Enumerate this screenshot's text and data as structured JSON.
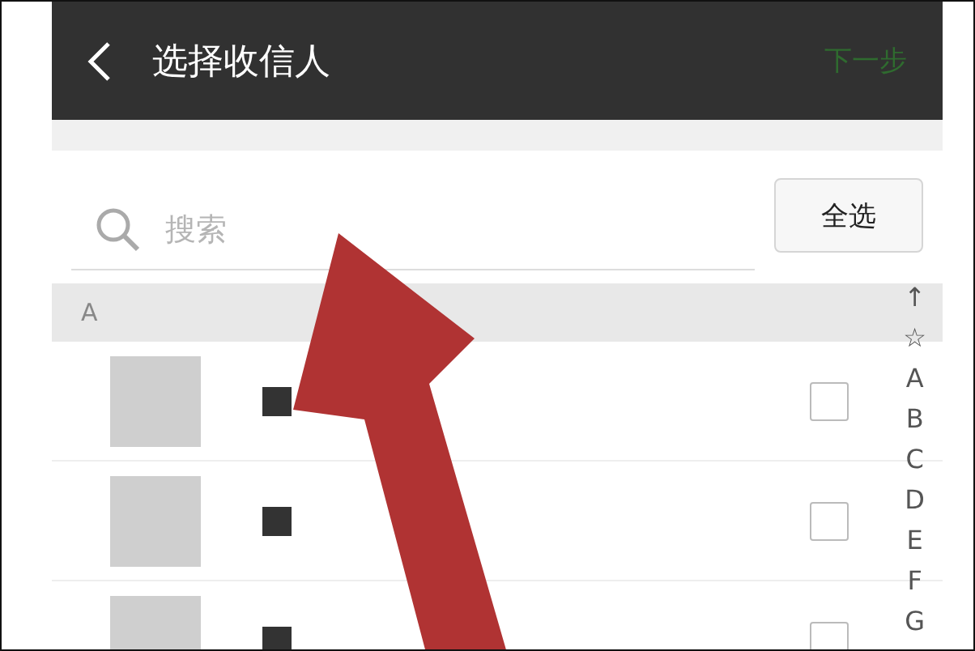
{
  "header": {
    "title": "选择收信人",
    "next_button": {
      "label": "下一步",
      "disabled": true
    }
  },
  "search": {
    "placeholder": "搜索"
  },
  "select_all_button": "全选",
  "section": {
    "letter": "A"
  },
  "contacts": [
    {
      "checked": false
    },
    {
      "checked": false
    },
    {
      "checked": false
    }
  ],
  "index": [
    "↑",
    "☆",
    "A",
    "B",
    "C",
    "D",
    "E",
    "F",
    "G"
  ]
}
